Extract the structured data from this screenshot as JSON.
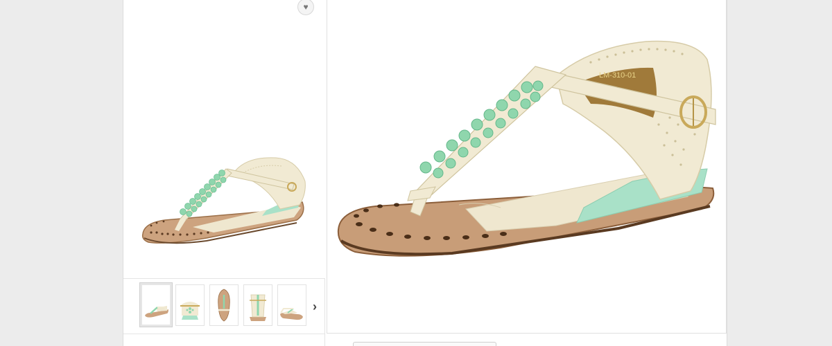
{
  "gallery": {
    "favorite_icon": "heart-icon",
    "next_icon": "chevron-right-icon",
    "thumbnails": [
      {
        "view": "side-left"
      },
      {
        "view": "front"
      },
      {
        "view": "top"
      },
      {
        "view": "back"
      },
      {
        "view": "side-right"
      }
    ],
    "active_thumbnail": 0
  },
  "zoom": {
    "label_on_insole": "LM-310-01"
  },
  "colors": {
    "strap": "#f1ead3",
    "studs": "#8fd6ad",
    "sole": "#cda37f",
    "wedge": "#a9e1c8",
    "buckle": "#c9a95a"
  }
}
